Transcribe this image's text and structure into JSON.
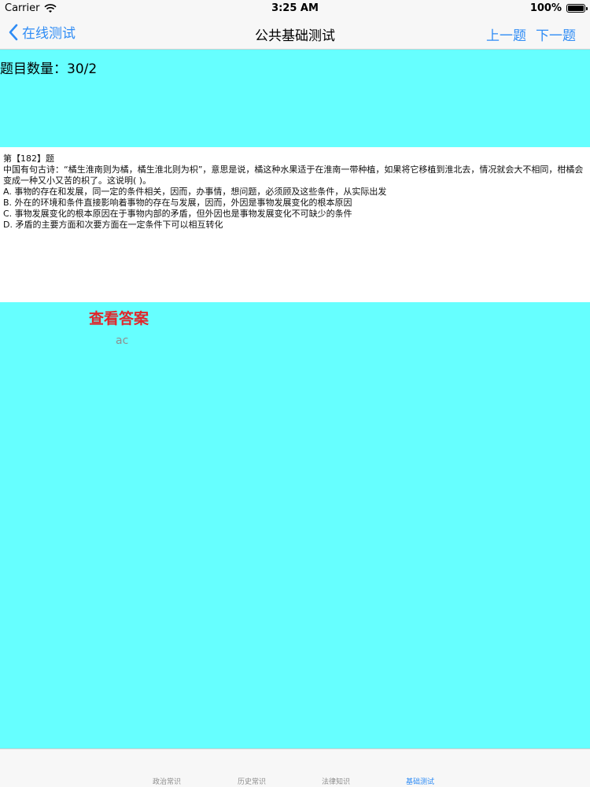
{
  "status_bar": {
    "carrier": "Carrier",
    "time": "3:25 AM",
    "battery": "100%"
  },
  "nav_bar": {
    "back_label": "在线测试",
    "title": "公共基础测试",
    "prev_label": "上一题",
    "next_label": "下一题"
  },
  "content": {
    "count_label": "题目数量：30/2",
    "question": {
      "number": "第【182】题",
      "stem": "中国有句古诗：“橘生淮南则为橘，橘生淮北则为枳”，意思是说，橘这种水果适于在淮南一带种植，如果将它移植到淮北去，情况就会大不相同，柑橘会变成一种又小又苦的枳了。这说明( )。",
      "options": [
        "A. 事物的存在和发展，同一定的条件相关，因而，办事情，想问题，必须顾及这些条件，从实际出发",
        "B. 外在的环境和条件直接影响着事物的存在与发展，因而，外因是事物发展变化的根本原因",
        "C. 事物发展变化的根本原因在于事物内部的矛盾，但外因也是事物发展变化不可缺少的条件",
        "D. 矛盾的主要方面和次要方面在一定条件下可以相互转化"
      ]
    },
    "show_answer_label": "查看答案",
    "answer": "ac"
  },
  "tab_bar": {
    "items": [
      {
        "label": "政治常识",
        "active": false
      },
      {
        "label": "历史常识",
        "active": false
      },
      {
        "label": "法律知识",
        "active": false
      },
      {
        "label": "基础测试",
        "active": true
      }
    ]
  },
  "colors": {
    "accent": "#2f8cf5",
    "content_bg": "#66ffff",
    "answer_button": "#e0262a"
  }
}
